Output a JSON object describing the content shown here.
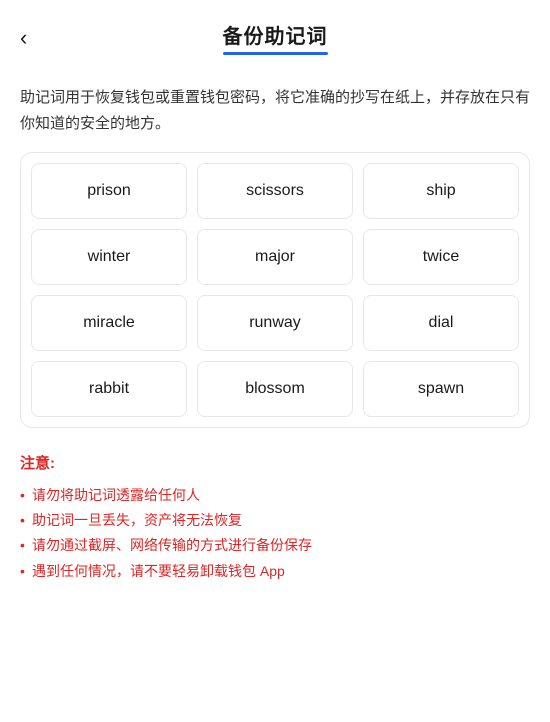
{
  "header": {
    "back_icon": "‹",
    "title": "备份助记词"
  },
  "description": "助记词用于恢复钱包或重置钱包密码，将它准确的抄写在纸上，并存放在只有你知道的安全的地方。",
  "mnemonic_words": [
    "prison",
    "scissors",
    "ship",
    "winter",
    "major",
    "twice",
    "miracle",
    "runway",
    "dial",
    "rabbit",
    "blossom",
    "spawn"
  ],
  "notice": {
    "title": "注意:",
    "items": [
      "请勿将助记词透露给任何人",
      "助记词一旦丢失，资产将无法恢复",
      "请勿通过截屏、网络传输的方式进行备份保存",
      "遇到任何情况，请不要轻易卸载钱包 App"
    ]
  }
}
